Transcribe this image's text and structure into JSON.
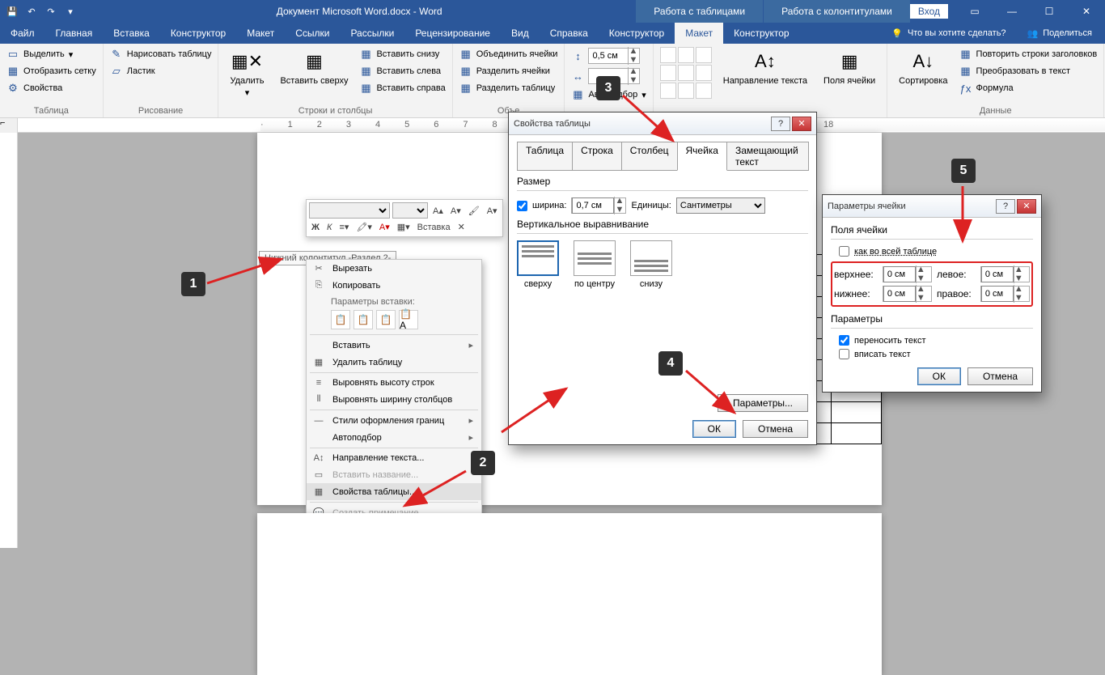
{
  "titlebar": {
    "doc_title": "Документ Microsoft Word.docx - Word",
    "login": "Вход",
    "ctx_table": "Работа с таблицами",
    "ctx_hf": "Работа с колонтитулами"
  },
  "tabs": {
    "file": "Файл",
    "home": "Главная",
    "insert": "Вставка",
    "design": "Конструктор",
    "layout": "Макет",
    "refs": "Ссылки",
    "mail": "Рассылки",
    "review": "Рецензирование",
    "view": "Вид",
    "help": "Справка",
    "ctx_design": "Конструктор",
    "ctx_layout": "Макет",
    "ctx_hf_design": "Конструктор",
    "tell_me": "Что вы хотите сделать?",
    "share": "Поделиться"
  },
  "ribbon": {
    "table": {
      "select": "Выделить",
      "grid": "Отобразить сетку",
      "props": "Свойства",
      "label": "Таблица"
    },
    "draw": {
      "draw": "Нарисовать таблицу",
      "eraser": "Ластик",
      "label": "Рисование"
    },
    "rc": {
      "delete": "Удалить",
      "ins_above": "Вставить сверху",
      "ins_below": "Вставить снизу",
      "ins_left": "Вставить слева",
      "ins_right": "Вставить справа",
      "label": "Строки и столбцы"
    },
    "merge": {
      "merge": "Объединить ячейки",
      "split": "Разделить ячейки",
      "split_tbl": "Разделить таблицу",
      "label": "Объе"
    },
    "size": {
      "h": "0,5 см",
      "autofit": "Автоподбор"
    },
    "align": {
      "dir": "Направление текста",
      "margins": "Поля ячейки"
    },
    "data": {
      "sort": "Сортировка",
      "repeat": "Повторить строки заголовков",
      "convert": "Преобразовать в текст",
      "formula": "Формула",
      "label": "Данные"
    }
  },
  "hf_label": "Нижний колонтитул -Раздел 2-",
  "mini_tb": {
    "font": "",
    "size": "",
    "insert": "Вставка",
    "bold": "Ж",
    "italic": "К"
  },
  "ctx_menu": {
    "cut": "Вырезать",
    "copy": "Копировать",
    "paste_opts": "Параметры вставки:",
    "insert": "Вставить",
    "del_table": "Удалить таблицу",
    "dist_rows": "Выровнять высоту строк",
    "dist_cols": "Выровнять ширину столбцов",
    "border_styles": "Стили оформления границ",
    "autofit": "Автоподбор",
    "text_dir": "Направление текста...",
    "ins_caption": "Вставить название...",
    "table_props": "Свойства таблицы...",
    "new_comment": "Создать примечание"
  },
  "dlg1": {
    "title": "Свойства таблицы",
    "tab_table": "Таблица",
    "tab_row": "Строка",
    "tab_col": "Столбец",
    "tab_cell": "Ячейка",
    "tab_alt": "Замещающий текст",
    "size": "Размер",
    "width_lbl": "ширина:",
    "width_val": "0,7 см",
    "units_lbl": "Единицы:",
    "units_val": "Сантиметры",
    "valign": "Вертикальное выравнивание",
    "top": "сверху",
    "center": "по центру",
    "bottom": "снизу",
    "options": "Параметры...",
    "ok": "ОК",
    "cancel": "Отмена"
  },
  "dlg2": {
    "title": "Параметры ячейки",
    "margins": "Поля ячейки",
    "same": "как во всей таблице",
    "top": "верхнее:",
    "bottom": "нижнее:",
    "left": "левое:",
    "right": "правое:",
    "val": "0 см",
    "options": "Параметры",
    "wrap": "переносить текст",
    "fit": "вписать текст",
    "ok": "ОК",
    "cancel": "Отмена"
  },
  "markers": {
    "m1": "1",
    "m2": "2",
    "m3": "3",
    "m4": "4",
    "m5": "5"
  }
}
